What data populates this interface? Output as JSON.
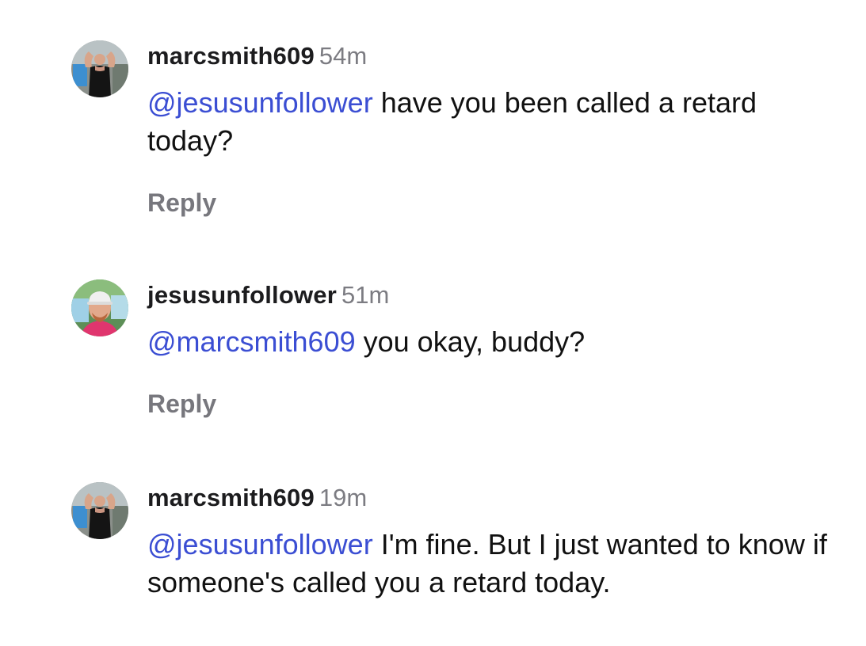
{
  "comments": [
    {
      "username": "marcsmith609",
      "time": "54m",
      "mention": "@jesusunfollower",
      "text": " have you been called a retard today?",
      "reply_label": "Reply",
      "avatar_icon": "profile-photo-flexing-man"
    },
    {
      "username": "jesusunfollower",
      "time": "51m",
      "mention": "@marcsmith609",
      "text": " you okay, buddy?",
      "reply_label": "Reply",
      "avatar_icon": "profile-photo-man-in-cap"
    },
    {
      "username": "marcsmith609",
      "time": "19m",
      "mention": "@jesusunfollower",
      "text": " I'm fine. But I just wanted to know if someone's called you a retard today.",
      "avatar_icon": "profile-photo-flexing-man"
    }
  ],
  "colors": {
    "mention": "#3b4ed3",
    "timestamp": "#7c7c82",
    "reply": "#77777d",
    "username": "#1c1c1e"
  }
}
